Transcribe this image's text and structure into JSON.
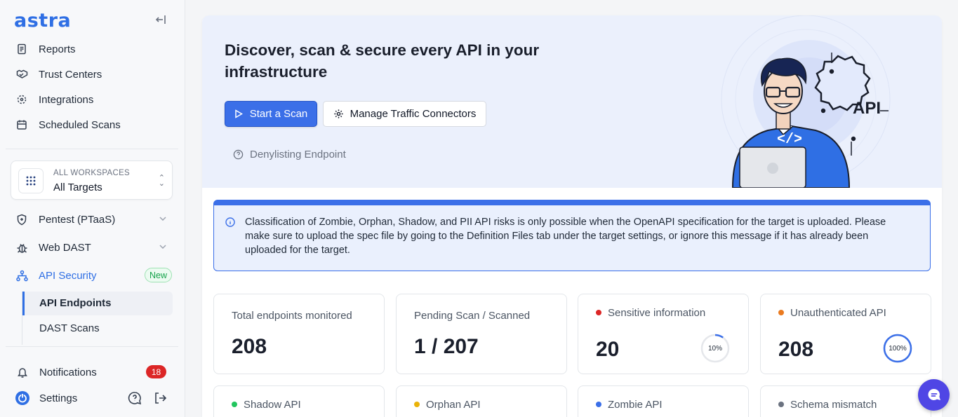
{
  "sidebar": {
    "logo": "astra",
    "top_items": [
      "Reports",
      "Trust Centers",
      "Integrations",
      "Scheduled Scans"
    ],
    "workspace": {
      "kicker": "ALL WORKSPACES",
      "name": "All Targets"
    },
    "sections": [
      "Pentest (PTaaS)",
      "Web DAST"
    ],
    "api_security": {
      "label": "API Security",
      "badge": "New"
    },
    "sub_items": [
      "API Endpoints",
      "DAST Scans"
    ],
    "notifications": {
      "label": "Notifications",
      "count": "18"
    },
    "settings": "Settings"
  },
  "hero": {
    "title": "Discover, scan & secure every API in your infrastructure",
    "primary_button": "Start a Scan",
    "secondary_button": "Manage Traffic Connectors",
    "help_link": "Denylisting Endpoint",
    "illustration_label": "API"
  },
  "alert": {
    "text": "Classification of Zombie, Orphan, Shadow, and PII API risks is only possible when the OpenAPI specification for the target is uploaded. Please make sure to upload the spec file by going to the Definition Files tab under the target settings, or ignore this message if it has already been uploaded for the target."
  },
  "stats": [
    {
      "label": "Total endpoints monitored",
      "value": "208"
    },
    {
      "label": "Pending Scan / Scanned",
      "value": "1 / 207"
    },
    {
      "label": "Sensitive information",
      "value": "20",
      "percent_text": "10%",
      "percent": 10,
      "color": "#dc2626"
    },
    {
      "label": "Unauthenticated API",
      "value": "208",
      "percent_text": "100%",
      "percent": 100,
      "color": "#ea7a1f"
    }
  ],
  "stats_row2": [
    {
      "label": "Shadow API",
      "color": "#22c55e"
    },
    {
      "label": "Orphan API",
      "color": "#eab308"
    },
    {
      "label": "Zombie API",
      "color": "#3b6fe8"
    },
    {
      "label": "Schema mismatch",
      "color": "#6b7280"
    }
  ]
}
